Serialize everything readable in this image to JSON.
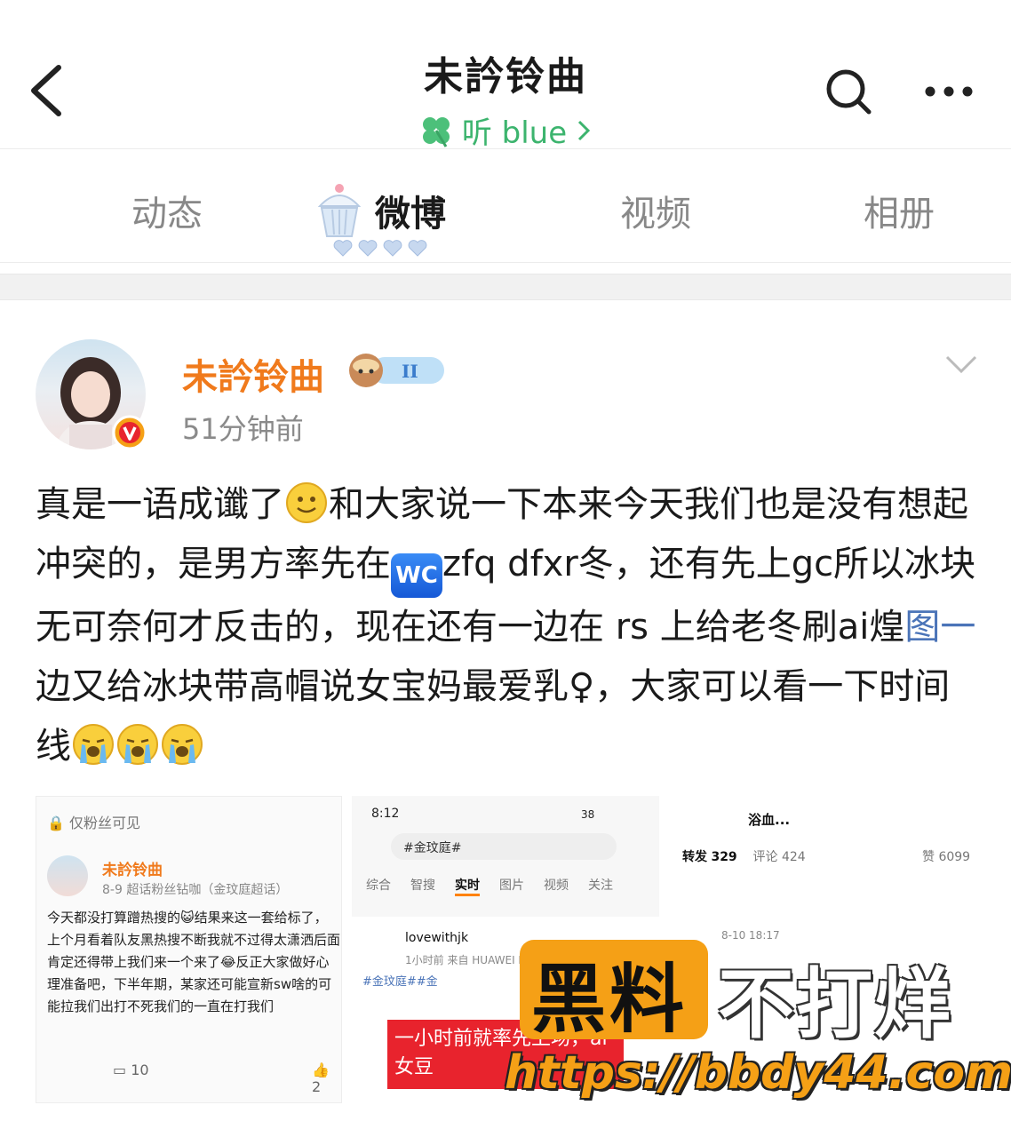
{
  "header": {
    "title": "未訡铃曲",
    "subtitle": "听 blue"
  },
  "tabs": [
    {
      "label": "动态",
      "active": false
    },
    {
      "label": "微博",
      "active": true
    },
    {
      "label": "视频",
      "active": false
    },
    {
      "label": "相册",
      "active": false
    }
  ],
  "post": {
    "author": "未訡铃曲",
    "level": "II",
    "time": "51分钟前",
    "text": {
      "p1": "真是一语成谶了",
      "p2": "和大家说一下本来今天我们也是没有想起冲突的，是男方率先在",
      "wc_label": "WC",
      "p3": "zfq dfxr冬，还有先上gc所以冰块无可奈何才反击的，现在还有一边在 rs 上给老冬刷ai煌",
      "link": "图一",
      "p4": "边又给冰块带高帽说女宝妈最爱乳♀，大家可以看一下时间线"
    }
  },
  "images": {
    "img1": {
      "visibility": "仅粉丝可见",
      "name": "未訡铃曲",
      "meta": "8-9  超话粉丝钻咖（金玟庭超话）",
      "text": "今天都没打算蹭热搜的😺结果来这一套给标了，上个月看着队友黑热搜不断我就不过得太潇洒后面肯定还得带上我们来一个来了😂反正大家做好心理准备吧，下半年期，某家还可能宣新sw啥的可能拉我们出打不死我们的一直在打我们",
      "comments": "10",
      "likes": "2"
    },
    "img2": {
      "time": "8:12",
      "battery": "38",
      "search": "#金玟庭#",
      "tabs": [
        "综合",
        "智搜",
        "实时",
        "图片",
        "视频",
        "关注"
      ],
      "active_tab": "实时",
      "user": "lovewithjk",
      "meta": "1小时前  来自 HUAWEI P",
      "tag": "#金玟庭##金",
      "red_text": "一小时前就率先上场，ai女豆"
    },
    "img3": {
      "name": "浴血...",
      "reposts_label": "转发",
      "reposts": "329",
      "comments_label": "评论",
      "comments": "424",
      "likes_label": "赞",
      "likes": "6099",
      "date": "8-10 18:17"
    }
  },
  "watermark": {
    "black": "黑料",
    "white": "不打烊",
    "url": "https://bbdy44.com"
  },
  "colors": {
    "accent_orange": "#f07a1c",
    "subtitle_green": "#3cb46e",
    "link_blue": "#4b74b8",
    "watermark_orange": "#f5a016"
  }
}
